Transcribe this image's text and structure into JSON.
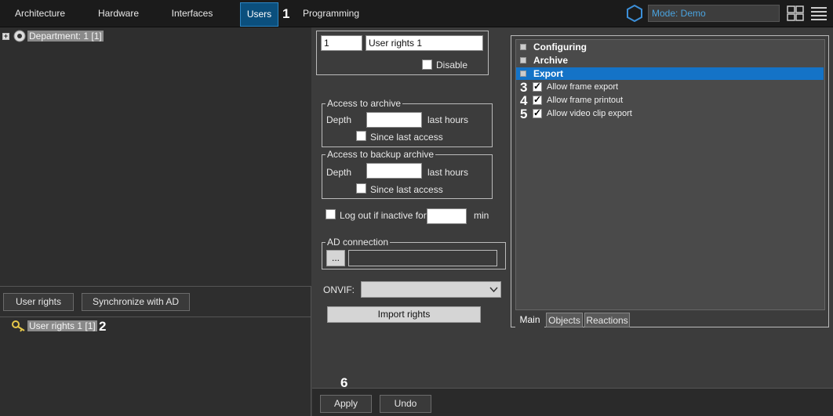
{
  "tabs": [
    {
      "label": "Architecture"
    },
    {
      "label": "Hardware"
    },
    {
      "label": "Interfaces"
    },
    {
      "label": "Users"
    },
    {
      "label": "Programming"
    }
  ],
  "callouts": [
    "1",
    "2",
    "3",
    "4",
    "5",
    "6"
  ],
  "mode": {
    "label": "Mode: Demo"
  },
  "tree": {
    "department": "Department: 1 [1]",
    "user_rights_item": "User rights 1 [1]"
  },
  "left_buttons": {
    "user_rights": "User rights",
    "sync_ad": "Synchronize with AD"
  },
  "rights_form": {
    "id_value": "1",
    "name_value": "User rights 1",
    "disable_label": "Disable",
    "archive": {
      "legend": "Access to archive",
      "depth_label": "Depth",
      "depth_value": "",
      "hours_label": "last hours",
      "since_label": "Since last access"
    },
    "backup": {
      "legend": "Access to backup archive",
      "depth_label": "Depth",
      "depth_value": "",
      "hours_label": "last hours",
      "since_label": "Since last access"
    },
    "logout_label": "Log out if inactive for",
    "logout_value": "",
    "min_label": "min",
    "ad": {
      "legend": "AD connection",
      "browse_label": "...",
      "value": ""
    },
    "onvif_label": "ONVIF:",
    "onvif_value": "",
    "import_label": "Import rights"
  },
  "rights_tree": {
    "categories": [
      {
        "label": "Configuring",
        "expanded": false
      },
      {
        "label": "Archive",
        "expanded": false
      },
      {
        "label": "Export",
        "expanded": true
      }
    ],
    "permissions": [
      {
        "label": "Allow frame export",
        "checked": true
      },
      {
        "label": "Allow frame printout",
        "checked": true
      },
      {
        "label": "Allow video clip export",
        "checked": true
      }
    ],
    "tabs": [
      {
        "label": "Main"
      },
      {
        "label": "Objects"
      },
      {
        "label": "Reactions"
      }
    ]
  },
  "footer": {
    "apply_label": "Apply",
    "undo_label": "Undo"
  },
  "colors": {
    "accent": "#1473c7",
    "active_tab": "#0b4f7d",
    "mode_text": "#4aa3df"
  },
  "icons": [
    "hexagon-icon",
    "layout-grid-icon",
    "menu-icon",
    "department-icon",
    "key-icon",
    "chevron-down-icon"
  ]
}
